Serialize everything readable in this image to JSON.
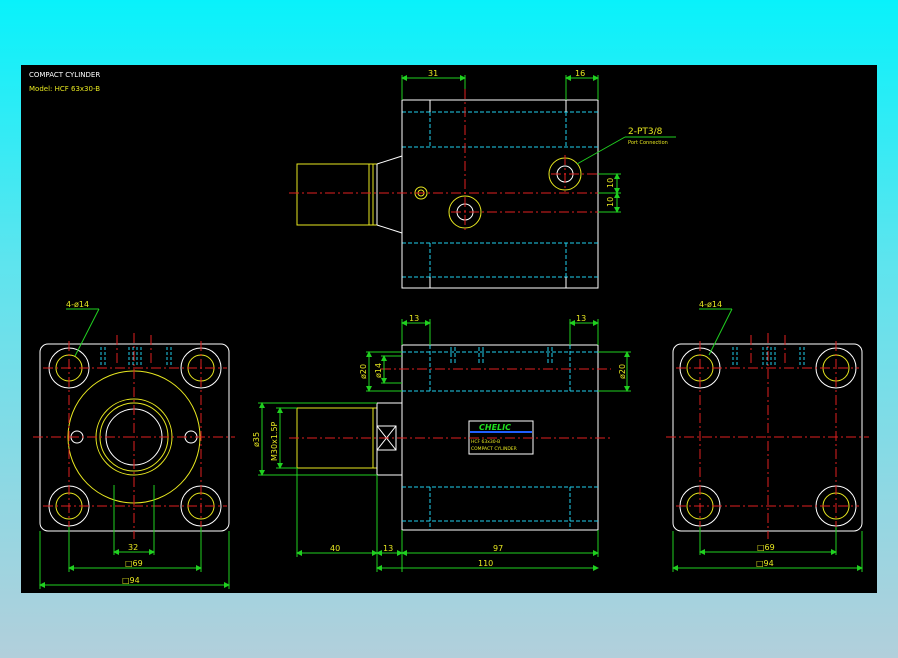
{
  "title_block": {
    "title": "COMPACT CYLINDER",
    "model": "Model: HCF 63x30-B"
  },
  "top_view": {
    "dim_top_left": "31",
    "dim_top_right": "16",
    "port_callout": "2-PT3/8",
    "port_sub": "Port Connection",
    "dim_10_a": "10",
    "dim_10_b": "10"
  },
  "left_view": {
    "hole_callout": "4-ø14",
    "dim_32": "32",
    "dim_69": "□69",
    "dim_94": "□94"
  },
  "front_view": {
    "dim_13_left": "13",
    "dim_13_right": "13",
    "dim_d20_left": "ø20",
    "dim_d14": "ø14",
    "dim_d20_right": "ø20",
    "dim_d35": "ø35",
    "dim_thread": "M30x1.5P",
    "dim_40": "40",
    "dim_13_bottom": "13",
    "dim_97": "97",
    "dim_110": "110",
    "label_brand": "CHELIC",
    "label_line1": "HCF 63x30-B",
    "label_line2": "COMPACT CYLINDER"
  },
  "right_view": {
    "hole_callout": "4-ø14",
    "dim_69": "□69",
    "dim_94": "□94"
  }
}
